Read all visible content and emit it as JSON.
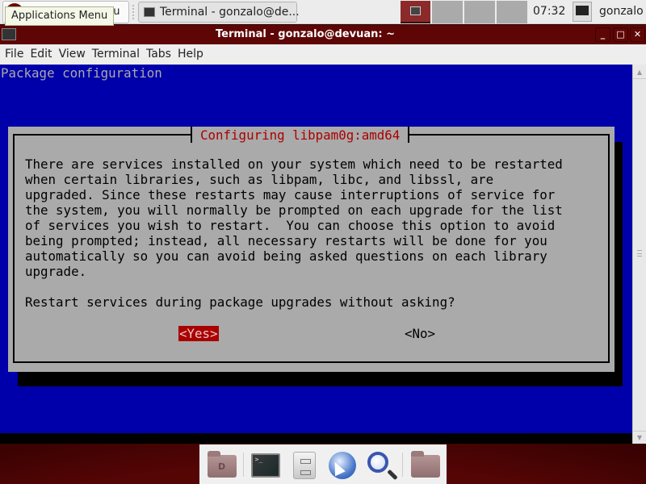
{
  "top_panel": {
    "apps_button_label": "Applications Menu",
    "apps_button_visible_suffix": "nu",
    "tooltip": "Applications Menu",
    "taskbar": [
      {
        "label": "Terminal - gonzalo@de...",
        "icon": "terminal-icon"
      }
    ],
    "workspaces": [
      {
        "index": 1,
        "active": true
      },
      {
        "index": 2,
        "active": false
      },
      {
        "index": 3,
        "active": false
      },
      {
        "index": 4,
        "active": false
      }
    ],
    "clock": "07:32",
    "user": {
      "name": "gonzalo",
      "icon": "network-user-icon"
    }
  },
  "window": {
    "title": "Terminal - gonzalo@devuan: ~",
    "controls": {
      "minimize": "_",
      "maximize": "□",
      "close": "✕"
    },
    "menu": [
      "File",
      "Edit",
      "View",
      "Terminal",
      "Tabs",
      "Help"
    ]
  },
  "terminal": {
    "header": "Package configuration",
    "colors": {
      "background": "#0000aa",
      "dialog": "#aaaaaa",
      "title": "#aa0000",
      "selected_button_bg": "#aa0000"
    },
    "dialog": {
      "title": "Configuring libpam0g:amd64",
      "lines": [
        "There are services installed on your system which need to be restarted",
        "when certain libraries, such as libpam, libc, and libssl, are",
        "upgraded. Since these restarts may cause interruptions of service for",
        "the system, you will normally be prompted on each upgrade for the list",
        "of services you wish to restart.  You can choose this option to avoid",
        "being prompted; instead, all necessary restarts will be done for you",
        "automatically so you can avoid being asked questions on each library",
        "upgrade."
      ],
      "question": "Restart services during package upgrades without asking?",
      "buttons": {
        "yes": "<Yes>",
        "no": "<No>"
      },
      "selected": "yes"
    }
  },
  "dock": {
    "items": [
      {
        "name": "home-folder",
        "icon": "home-folder-icon"
      },
      {
        "name": "terminal",
        "icon": "terminal-icon"
      },
      {
        "name": "file-manager",
        "icon": "file-cabinet-icon"
      },
      {
        "name": "web-browser",
        "icon": "globe-icon"
      },
      {
        "name": "app-finder",
        "icon": "search-icon"
      },
      {
        "name": "folder",
        "icon": "folder-icon"
      }
    ]
  }
}
